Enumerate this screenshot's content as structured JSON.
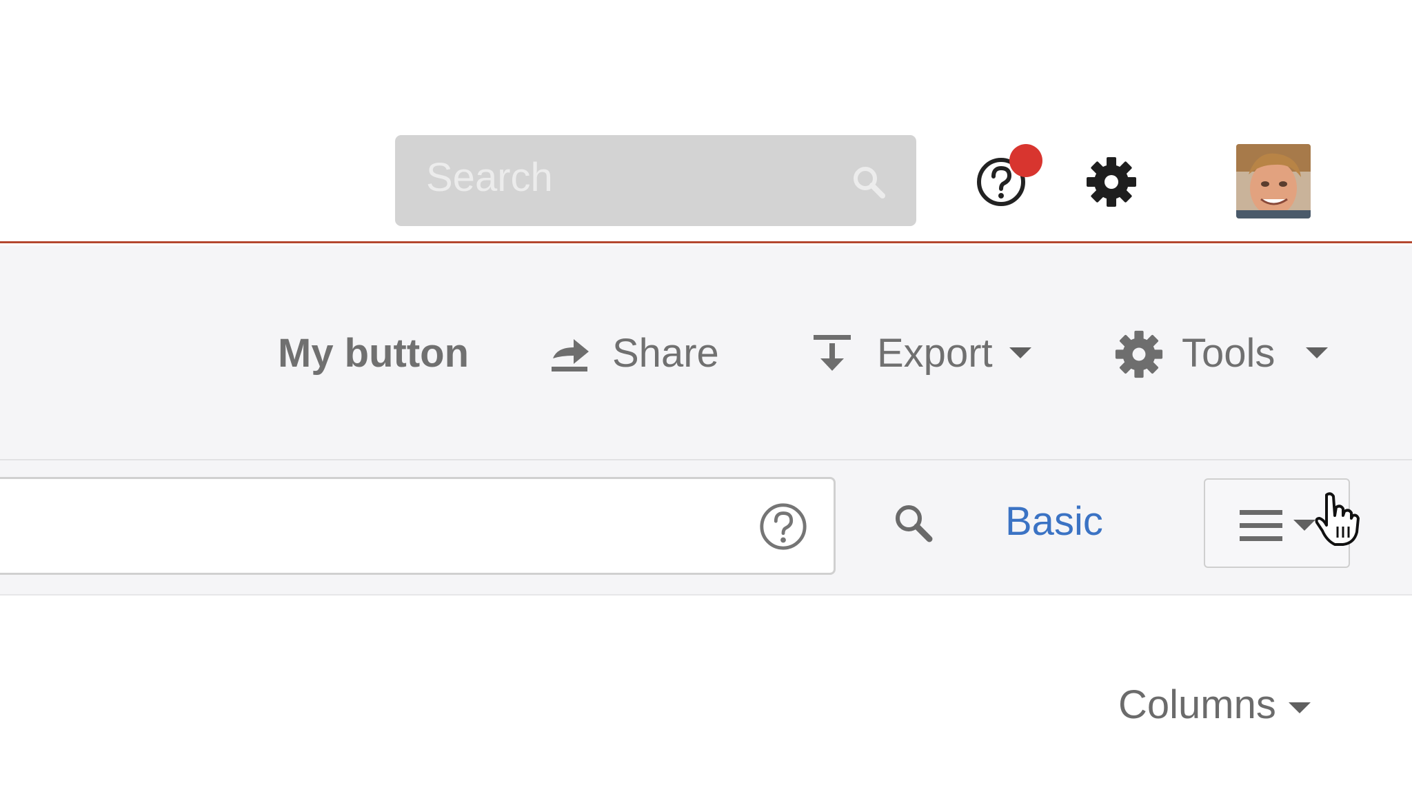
{
  "header": {
    "search": {
      "placeholder": "Search",
      "icon": "search-icon"
    },
    "help": {
      "icon": "help-icon",
      "badge_color": "#d8352f"
    },
    "settings": {
      "icon": "gear-icon"
    },
    "profile": {
      "icon": "avatar"
    },
    "accent_color": "#b4472f"
  },
  "toolbar": {
    "my_button_label": "My button",
    "share_label": "Share",
    "export_label": "Export",
    "tools_label": "Tools"
  },
  "query": {
    "input_value": "",
    "help_icon": "help-icon",
    "search_icon": "search-icon",
    "basic_label": "Basic",
    "menu_icon": "hamburger-menu-icon"
  },
  "results": {
    "columns_label": "Columns"
  },
  "colors": {
    "link": "#3b73c4",
    "toolbar_bg": "#f5f5f7",
    "text_muted": "#707070"
  }
}
